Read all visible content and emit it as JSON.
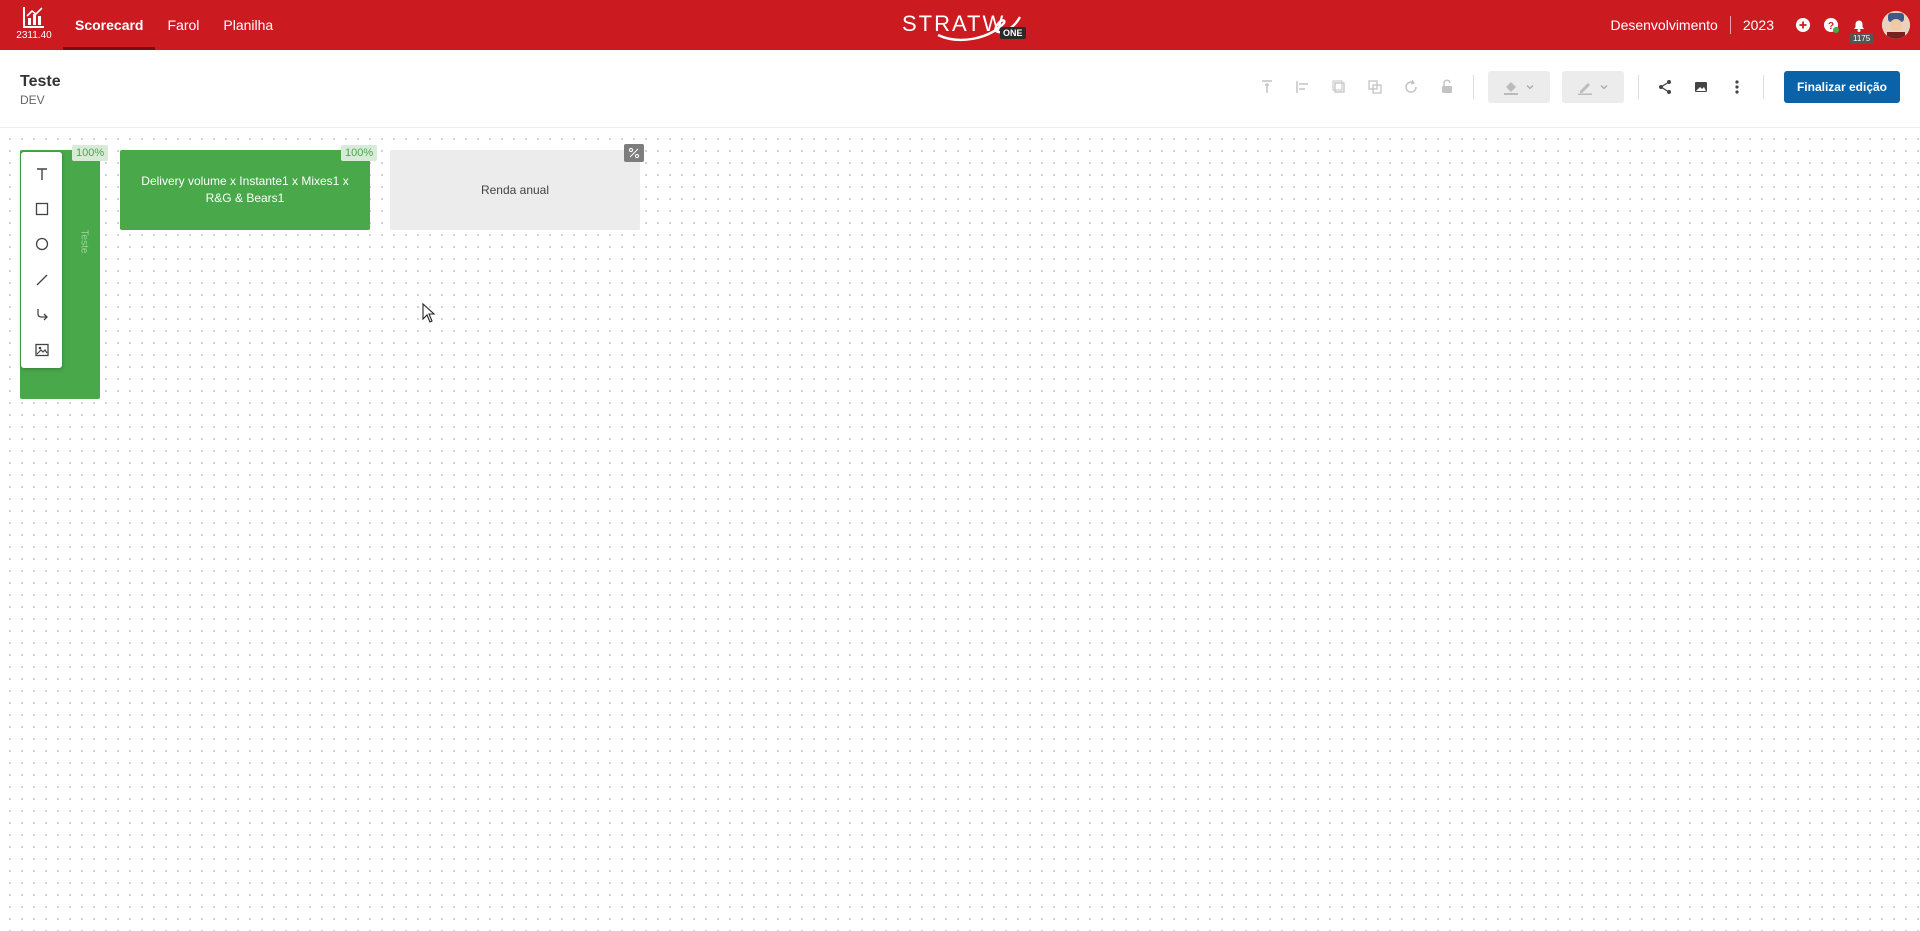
{
  "topbar": {
    "version": "2311.40",
    "nav": [
      {
        "label": "Scorecard",
        "active": true
      },
      {
        "label": "Farol",
        "active": false
      },
      {
        "label": "Planilha",
        "active": false
      }
    ],
    "brand": {
      "word": "STRATW",
      "one": "ONE"
    },
    "context": "Desenvolvimento",
    "year": "2023",
    "notifications_count": "1175",
    "icons": [
      "add-circle-icon",
      "help-icon",
      "bell-icon",
      "avatar"
    ]
  },
  "page": {
    "title": "Teste",
    "subtitle": "DEV",
    "toolbar": {
      "icons": [
        "align-top-icon",
        "align-left-icon",
        "bring-front-icon",
        "send-back-icon",
        "rotate-icon",
        "unlock-icon",
        "fill-color-icon",
        "stroke-color-icon",
        "share-icon",
        "image-export-icon",
        "more-vertical-icon"
      ],
      "primary_label": "Finalizar edição"
    }
  },
  "canvas": {
    "nodes": [
      {
        "label": "Delivery volume x Instante1 x Mixes1 x R&G & Bears1",
        "percent": "100%",
        "color": "#48a84a"
      },
      {
        "label": "Renda anual",
        "percent_icon": "percent-icon",
        "color": "#ececec"
      },
      {
        "label": "Teste",
        "percent": "100%",
        "color": "#48a84a"
      }
    ],
    "draw_tools": [
      "text-tool-icon",
      "rectangle-tool-icon",
      "ellipse-tool-icon",
      "line-tool-icon",
      "connector-tool-icon",
      "image-tool-icon"
    ]
  },
  "colors": {
    "header": "#cc1a21",
    "primary": "#0a63a8",
    "green": "#48a84a"
  }
}
